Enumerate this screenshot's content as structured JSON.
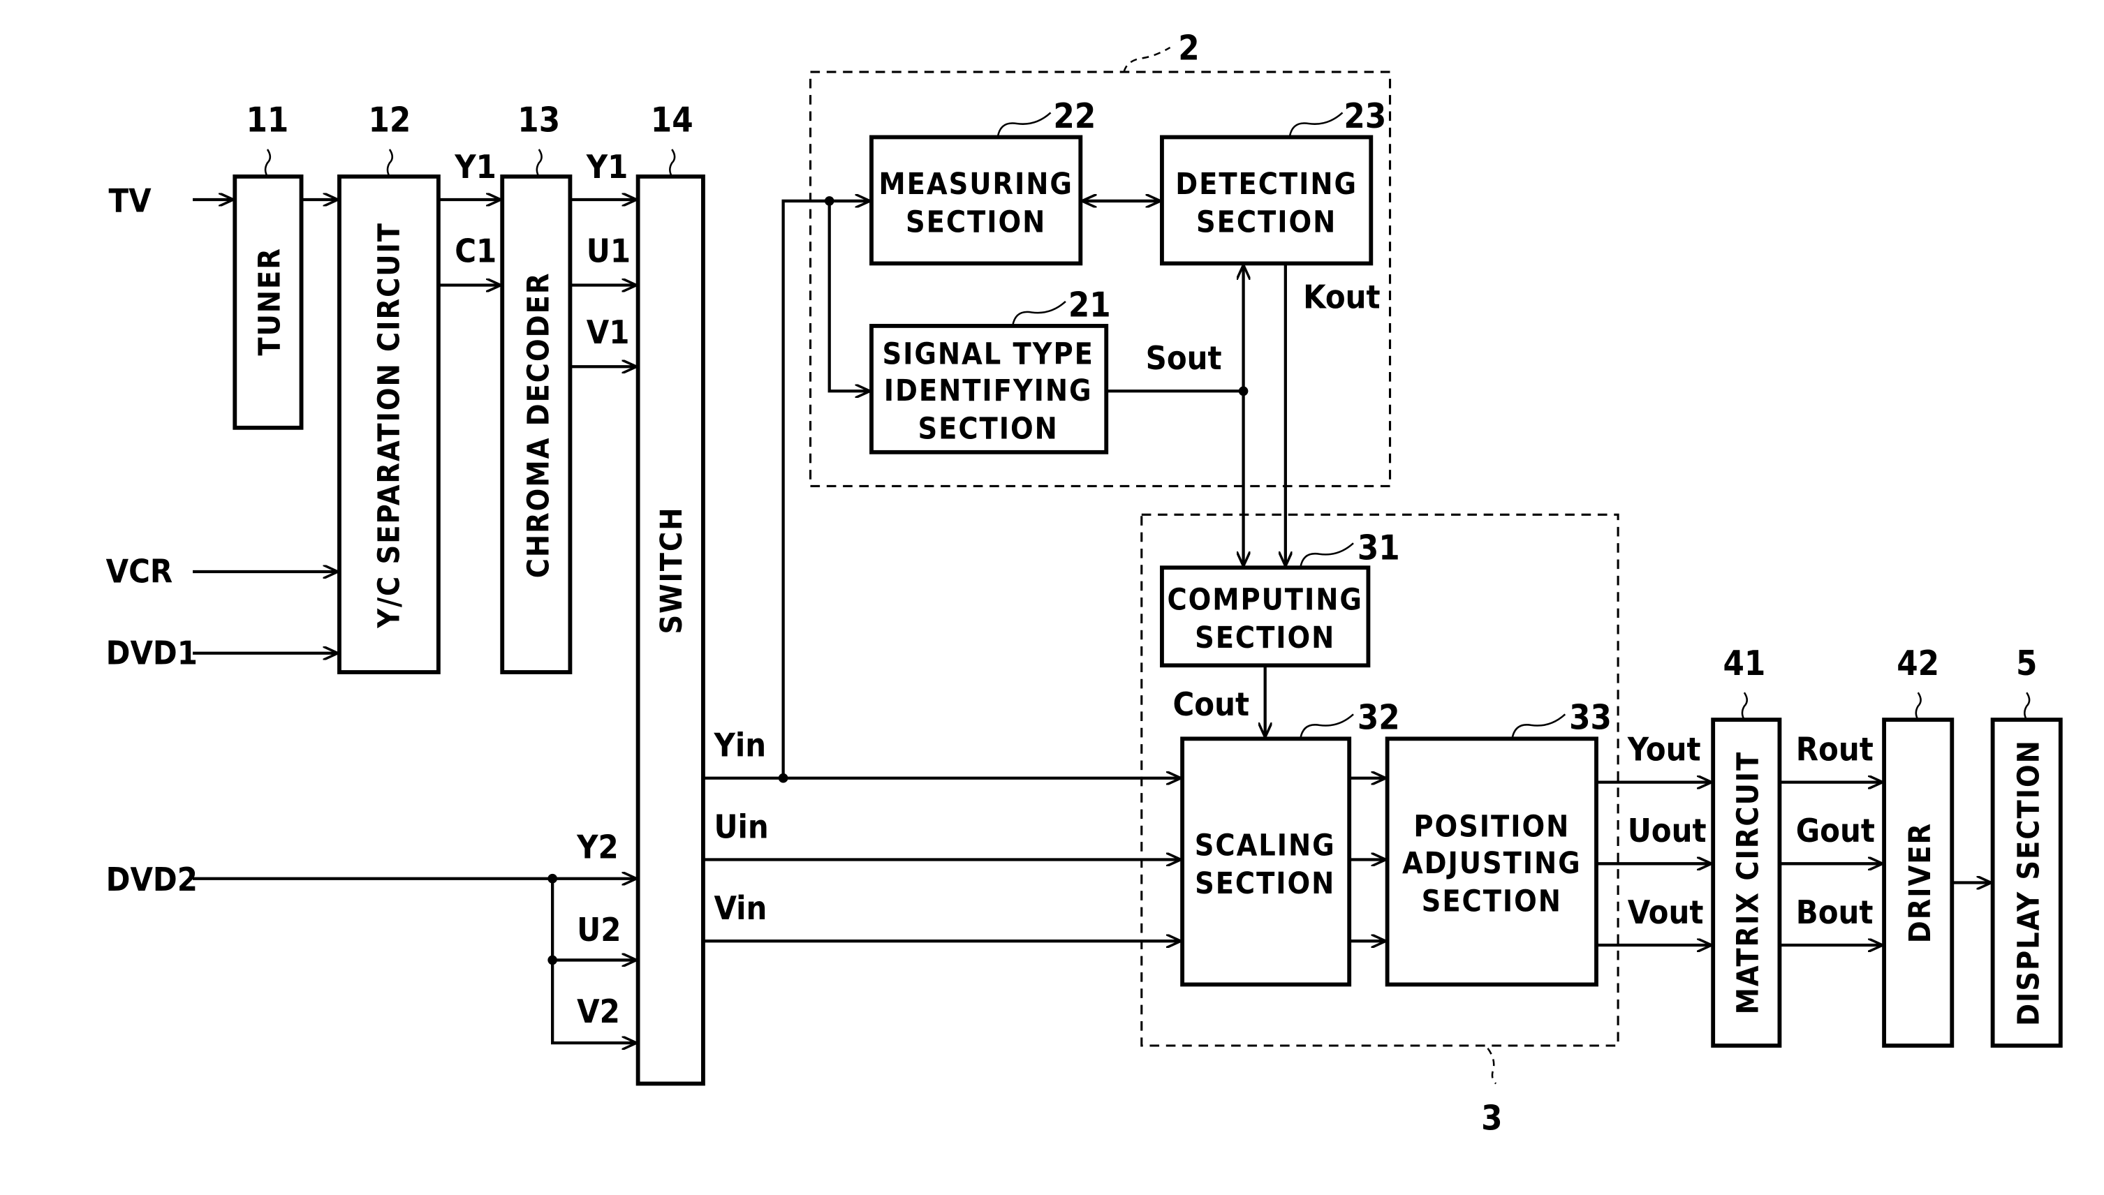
{
  "colors": {
    "ink": "#000000",
    "paper": "#ffffff"
  },
  "inputs": {
    "tv": "TV",
    "vcr": "VCR",
    "dvd1": "DVD1",
    "dvd2": "DVD2"
  },
  "blocks": {
    "tuner": {
      "ref": "11",
      "label": "TUNER"
    },
    "yc_separation": {
      "ref": "12",
      "label": "Y/C SEPARATION CIRCUIT"
    },
    "chroma_decoder": {
      "ref": "13",
      "label": "CHROMA DECODER"
    },
    "switch": {
      "ref": "14",
      "label": "SWITCH"
    },
    "signal_type_identifying": {
      "ref": "21",
      "lines": [
        "SIGNAL TYPE",
        "IDENTIFYING",
        "SECTION"
      ]
    },
    "measuring": {
      "ref": "22",
      "lines": [
        "MEASURING",
        "SECTION"
      ]
    },
    "detecting": {
      "ref": "23",
      "lines": [
        "DETECTING",
        "SECTION"
      ]
    },
    "computing": {
      "ref": "31",
      "lines": [
        "COMPUTING",
        "SECTION"
      ]
    },
    "scaling": {
      "ref": "32",
      "lines": [
        "SCALING",
        "SECTION"
      ]
    },
    "position_adjusting": {
      "ref": "33",
      "lines": [
        "POSITION",
        "ADJUSTING",
        "SECTION"
      ]
    },
    "matrix_circuit": {
      "ref": "41",
      "label": "MATRIX CIRCUIT"
    },
    "driver": {
      "ref": "42",
      "label": "DRIVER"
    },
    "display_section": {
      "ref": "5",
      "label": "DISPLAY SECTION"
    }
  },
  "groups": {
    "group2": {
      "ref": "2"
    },
    "group3": {
      "ref": "3"
    }
  },
  "signals": {
    "y1_a": "Y1",
    "c1": "C1",
    "y1_b": "Y1",
    "u1": "U1",
    "v1": "V1",
    "y2": "Y2",
    "u2": "U2",
    "v2": "V2",
    "yin": "Yin",
    "uin": "Uin",
    "vin": "Vin",
    "sout": "Sout",
    "kout": "Kout",
    "cout": "Cout",
    "yout": "Yout",
    "uout": "Uout",
    "vout": "Vout",
    "rout": "Rout",
    "gout": "Gout",
    "bout": "Bout"
  }
}
